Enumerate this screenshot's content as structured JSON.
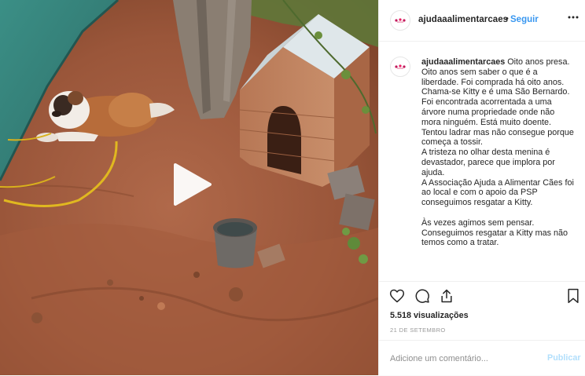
{
  "post": {
    "username": "ajudaaalimentarcaes",
    "separator": "•",
    "follow_label": "Seguir",
    "more_icon": "more-options-icon",
    "caption": {
      "username": "ajudaaalimentarcaes",
      "paragraph1": "Oito anos presa. Oito anos sem saber o que é a liberdade. Foi comprada há oito anos. Chama-se Kitty e é uma São Bernardo. Foi encontrada acorrentada a uma árvore numa propriedade onde não mora ninguém. Está muito doente. Tentou ladrar mas não consegue porque começa a tossir.",
      "paragraph2": "A tristeza no olhar desta menina é devastador, parece que implora por ajuda.",
      "paragraph3": "A Associação Ajuda a Alimentar Cães foi ao local e com o apoio da PSP conseguimos resgatar a Kitty.",
      "paragraph4": "Às vezes agimos sem pensar. Conseguimos resgatar a Kitty mas não temos como a tratar."
    },
    "actions": {
      "like_icon": "heart-icon",
      "comment_icon": "comment-icon",
      "share_icon": "share-icon",
      "save_icon": "bookmark-icon"
    },
    "views": "5.518 visualizações",
    "date": "21 DE SETEMBRO",
    "comment": {
      "placeholder": "Adicione um comentário...",
      "publish_label": "Publicar"
    },
    "colors": {
      "link_blue": "#3897f0",
      "publish_disabled": "#b2dffc",
      "text": "#262626",
      "muted": "#8e8e8e"
    }
  },
  "media": {
    "type": "video",
    "play_icon": "play-icon"
  }
}
